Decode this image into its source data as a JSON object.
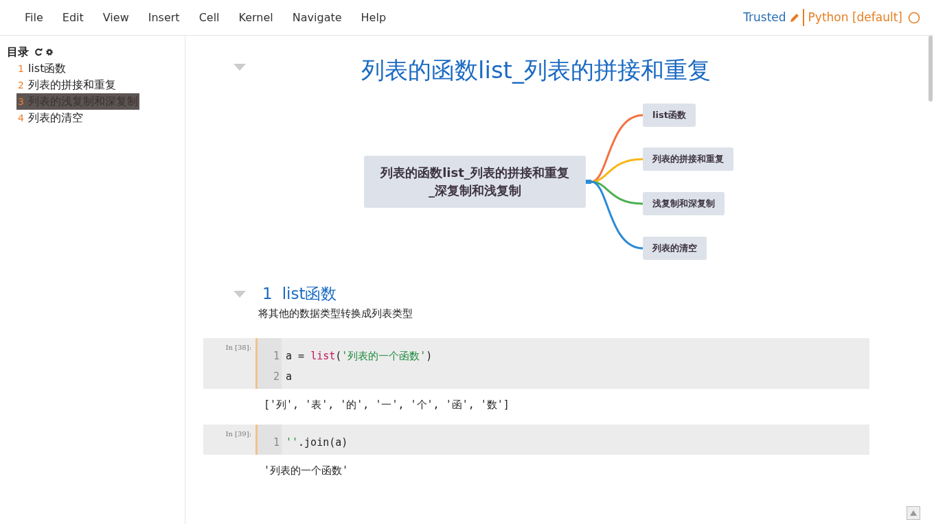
{
  "menu": [
    "File",
    "Edit",
    "View",
    "Insert",
    "Cell",
    "Kernel",
    "Navigate",
    "Help"
  ],
  "status": {
    "trusted": "Trusted",
    "kernel": "Python [default]"
  },
  "toc": {
    "title": "目录",
    "items": [
      {
        "number": "1",
        "label": "list函数",
        "selected": false
      },
      {
        "number": "2",
        "label": "列表的拼接和重复",
        "selected": false
      },
      {
        "number": "3",
        "label": "列表的浅复制和深复制",
        "selected": true
      },
      {
        "number": "4",
        "label": "列表的清空",
        "selected": false
      }
    ]
  },
  "notebook": {
    "title": "列表的函数list_列表的拼接和重复",
    "mindmap": {
      "root": "列表的函数list_列表的拼接和重复_深复制和浅复制",
      "branches": [
        {
          "label": "list函数",
          "color": "#f47142"
        },
        {
          "label": "列表的拼接和重复",
          "color": "#f9b617"
        },
        {
          "label": "浅复制和深复制",
          "color": "#4caf50"
        },
        {
          "label": "列表的清空",
          "color": "#2b8ad6"
        }
      ]
    },
    "section": {
      "number": "1",
      "title": "list函数",
      "text": "将其他的数据类型转换成列表类型"
    },
    "cells": [
      {
        "prompt": "In [38]:",
        "lines": [
          {
            "number": "1",
            "tokens": [
              {
                "text": "a = ",
                "kind": "plain"
              },
              {
                "text": "list",
                "kind": "builtin"
              },
              {
                "text": "(",
                "kind": "plain"
              },
              {
                "text": "'列表的一个函数'",
                "kind": "string"
              },
              {
                "text": ")",
                "kind": "plain"
              }
            ]
          },
          {
            "number": "2",
            "tokens": [
              {
                "text": "a",
                "kind": "plain"
              }
            ]
          }
        ],
        "output": "['列', '表', '的', '一', '个', '函', '数']"
      },
      {
        "prompt": "In [39]:",
        "lines": [
          {
            "number": "1",
            "tokens": [
              {
                "text": "''",
                "kind": "string"
              },
              {
                "text": ".join(a)",
                "kind": "plain"
              }
            ]
          }
        ],
        "output": "'列表的一个函数'"
      }
    ]
  }
}
